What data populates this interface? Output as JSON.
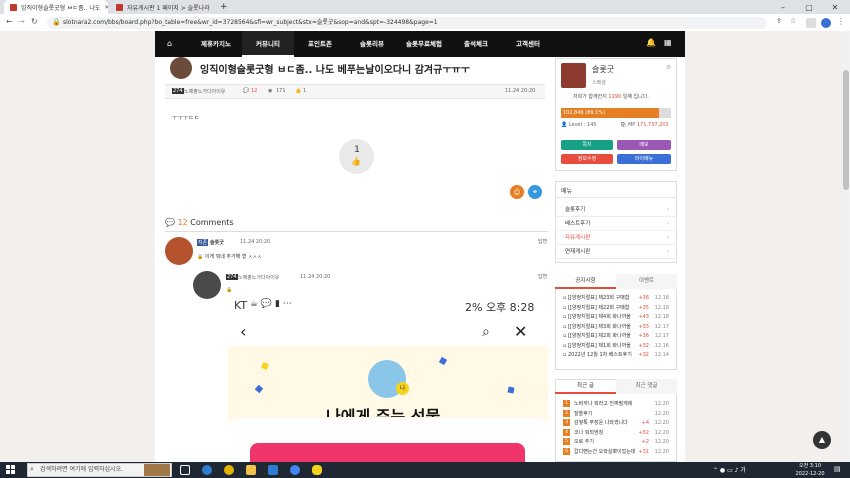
{
  "browser": {
    "tabs": [
      {
        "title": "잉직이형슬롯굿형 ㅂㄷ좀.. 나도"
      },
      {
        "title": "자유게시판 1 페이지 > 슬롯나라"
      }
    ],
    "new_tab": "+",
    "url": "slotnara2.com/bbs/board.php?bo_table=free&wr_id=3728564&sfl=wr_subject&stx=슬롯굿&sop=and&spt=-324498&page=1"
  },
  "nav": {
    "items": [
      "제휴카지노",
      "커뮤니티",
      "포인트존",
      "슬롯리뷰",
      "슬롯무료체험",
      "출석체크",
      "고객센터"
    ],
    "active_index": 1
  },
  "post": {
    "title": "잉직이형슬롯굿형 ㅂㄷ좀.. 나도 베푸는날이오다니 감겨규ㅜㅠㅜ",
    "author_level": "274",
    "author": "노예출노가다아이유",
    "comments": "12",
    "views": "171",
    "likes": "1",
    "date": "11.24 20:20",
    "body": "ㅜㅜㅜㄷㄷ",
    "like_count": "1"
  },
  "comments": {
    "count": "12",
    "label": "Comments",
    "items": [
      {
        "level": "지존",
        "author": "슬롯굿",
        "date": "11.24 20:20",
        "reply": "답변",
        "text": "이게 뭐네 추가해 형 ㅅㅅㅅ"
      },
      {
        "level": "274",
        "author": "노예출노가다아이유",
        "date": "11.24 20:20",
        "reply": "답변"
      }
    ]
  },
  "phone_screenshot": {
    "status_left": "KT",
    "status_right": "2% 오후 8:28",
    "banner": "나에게 주는 선물",
    "badge": "나"
  },
  "sidebar": {
    "username": "슬롯굿",
    "rank": "스페셜",
    "msg_prefix": "저희가 함께한지",
    "days": "1190",
    "msg_suffix": "일째 입니다.",
    "exp": "102,846 (89.1%)",
    "exp_percent": 89.1,
    "level_label": "Level : 145",
    "mp_label": "MP",
    "mp_value": "171,737,201",
    "buttons": [
      "쪽지",
      "메모",
      "정보수정",
      "마이메뉴"
    ],
    "menu_title": "메뉴",
    "menu": [
      "슬롯후기",
      "베스트후기",
      "자유게시판",
      "연재게시판"
    ],
    "tabs": [
      "공지사항",
      "이벤트"
    ],
    "notices": [
      {
        "t": "[[양정지럴표] 제23회 구매함",
        "c": "+36",
        "d": "12.18"
      },
      {
        "t": "[[양정지럴표] 제22회 구매함",
        "c": "+35",
        "d": "12.18"
      },
      {
        "t": "[[양정지럴표] 제4회 화나까올",
        "c": "+43",
        "d": "12.18"
      },
      {
        "t": "[[양정지럴표] 제3회 화나까올",
        "c": "+33",
        "d": "12.17"
      },
      {
        "t": "[[양정지럴표] 제2회 화나까올",
        "c": "+36",
        "d": "12.17"
      },
      {
        "t": "[[양정지럴표] 제1회 화나까올",
        "c": "+32",
        "d": "12.16"
      },
      {
        "t": "2022년 12월 1차 베스트후기",
        "c": "+32",
        "d": "12.14"
      }
    ],
    "recent_tabs": [
      "최근 글",
      "최근 댓글"
    ],
    "recent": [
      {
        "n": "1",
        "t": "노바까나 뭐라고 진짜필게에",
        "c": "",
        "d": "12.20"
      },
      {
        "n": "2",
        "t": "잘쓸후기",
        "c": "",
        "d": "12.20"
      },
      {
        "n": "3",
        "t": "감쌓톡 푸장운 나와썼니다",
        "c": "+4",
        "d": "12.20"
      },
      {
        "n": "4",
        "t": "코나 뭐되엔징",
        "c": "+52",
        "d": "12.20"
      },
      {
        "n": "5",
        "t": "오로 추기",
        "c": "+2",
        "d": "12.20"
      },
      {
        "n": "6",
        "t": "캅디뻔는건 오락실뽀이었는데",
        "c": "+31",
        "d": "12.20"
      }
    ]
  },
  "taskbar": {
    "search_placeholder": "검색하려면 여기에 입력하십시오.",
    "time": "오전 3:10",
    "date": "2022-12-20"
  },
  "colors": {
    "nav_bg": "#111111",
    "accent_orange": "#e67e22",
    "teal": "#16a085",
    "purple": "#9b59b6",
    "red": "#e74c3c",
    "blue": "#3498db"
  }
}
